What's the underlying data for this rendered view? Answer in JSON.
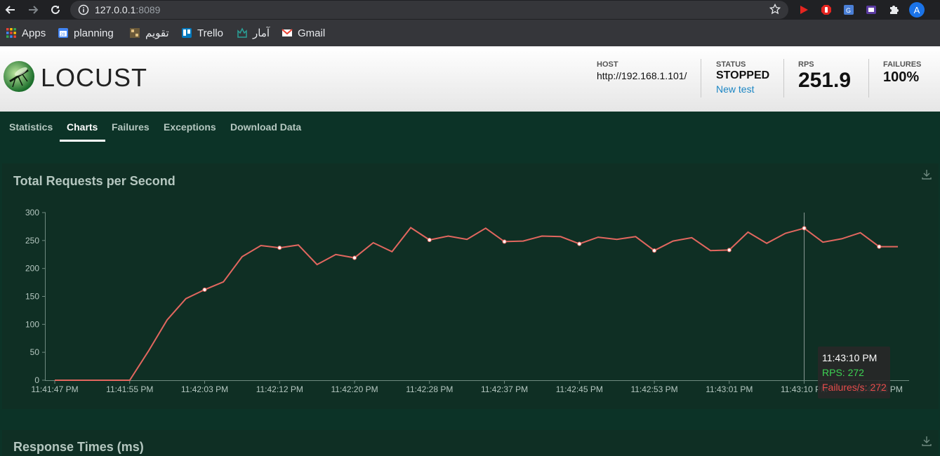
{
  "browser": {
    "url_host": "127.0.0.1",
    "url_port": ":8089",
    "avatar_initial": "A",
    "bookmarks": [
      {
        "label": "Apps",
        "icon": "apps-grid-icon"
      },
      {
        "label": "planning",
        "icon": "calendar-icon"
      },
      {
        "label": "تقویم",
        "icon": "calendar-persian-icon"
      },
      {
        "label": "Trello",
        "icon": "trello-icon"
      },
      {
        "label": "آمار",
        "icon": "stats-icon"
      },
      {
        "label": "Gmail",
        "icon": "gmail-icon"
      }
    ]
  },
  "header": {
    "logo_text": "LOCUST",
    "host_label": "HOST",
    "host_value": "http://192.168.1.101/",
    "status_label": "STATUS",
    "status_value": "STOPPED",
    "new_test_label": "New test",
    "rps_label": "RPS",
    "rps_value": "251.9",
    "failures_label": "FAILURES",
    "failures_value": "100%"
  },
  "tabs": [
    {
      "label": "Statistics",
      "active": false
    },
    {
      "label": "Charts",
      "active": true
    },
    {
      "label": "Failures",
      "active": false
    },
    {
      "label": "Exceptions",
      "active": false
    },
    {
      "label": "Download Data",
      "active": false
    }
  ],
  "panels": {
    "rps_title": "Total Requests per Second",
    "response_title": "Response Times (ms)"
  },
  "tooltip": {
    "time": "11:43:10 PM",
    "rps": "RPS: 272",
    "failures": "Failures/s: 272"
  },
  "colors": {
    "line": "#e2675f",
    "rps_green": "#3dd353",
    "failure_red": "#e84c4c",
    "panel_bg": "#0f2f24",
    "page_bg": "#0c3327"
  },
  "chart_data": {
    "type": "line",
    "title": "Total Requests per Second",
    "ylim": [
      0,
      300
    ],
    "yticks": [
      0,
      50,
      100,
      150,
      200,
      250,
      300
    ],
    "xticks": [
      "11:41:47 PM",
      "11:41:55 PM",
      "11:42:03 PM",
      "11:42:12 PM",
      "11:42:20 PM",
      "11:42:28 PM",
      "11:42:37 PM",
      "11:42:45 PM",
      "11:42:53 PM",
      "11:43:01 PM",
      "11:43:10 PM",
      "11:43:18 PM"
    ],
    "x_count": 46,
    "series": [
      {
        "name": "RPS",
        "values": [
          0,
          0,
          0,
          0,
          0,
          52,
          108,
          146,
          162,
          176,
          221,
          241,
          237,
          242,
          207,
          225,
          219,
          246,
          230,
          273,
          251,
          258,
          252,
          272,
          248,
          249,
          258,
          257,
          244,
          256,
          252,
          257,
          232,
          249,
          255,
          232,
          233,
          265,
          245,
          263,
          272,
          247,
          253,
          264,
          239,
          239
        ],
        "markers": [
          8,
          12,
          16,
          20,
          24,
          28,
          32,
          36,
          40,
          44
        ]
      }
    ],
    "highlight_index": 40
  }
}
